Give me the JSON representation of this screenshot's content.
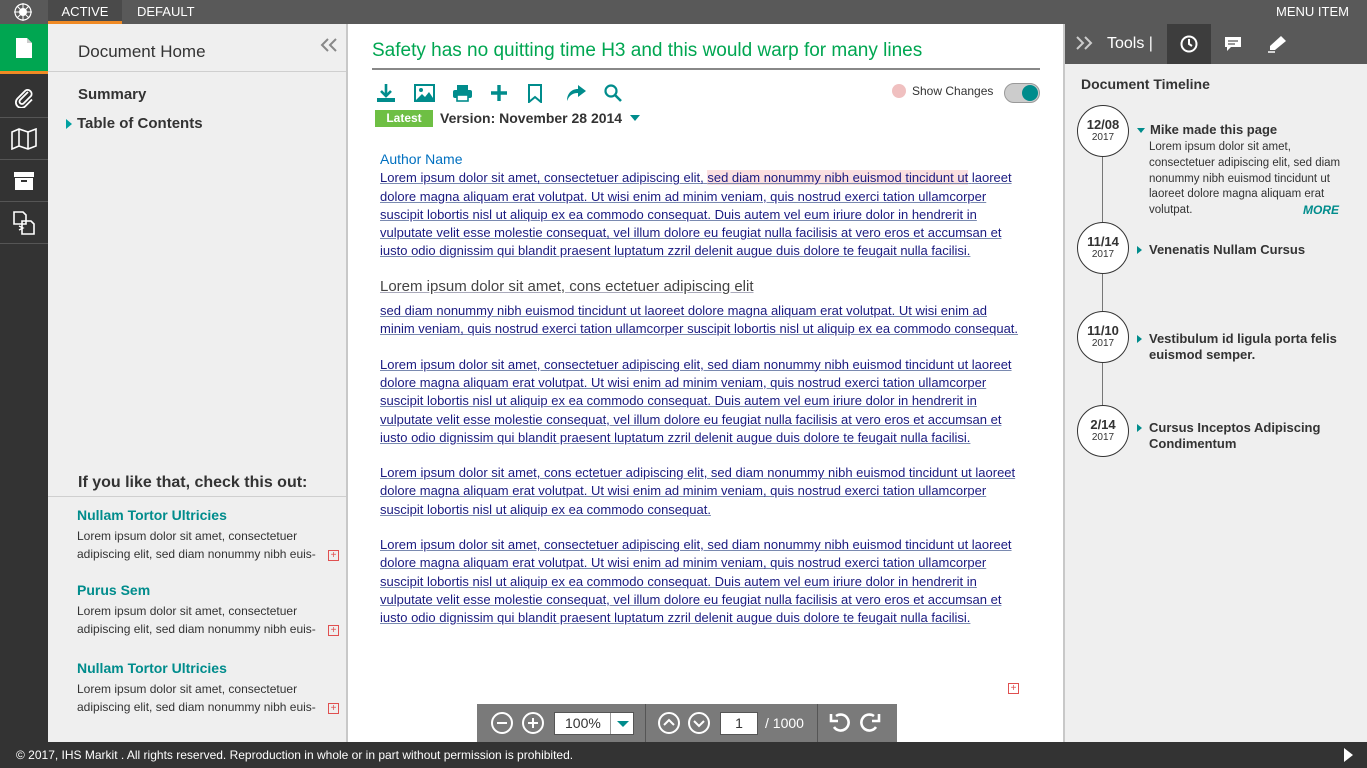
{
  "topbar": {
    "tabs": [
      "ACTIVE",
      "DEFAULT"
    ],
    "menu_item": "MENU ITEM"
  },
  "rail": {
    "icons": [
      "document-icon",
      "paperclip-icon",
      "map-icon",
      "archive-icon",
      "compare-icon"
    ]
  },
  "left_panel": {
    "home_label": "Document Home",
    "summary_label": "Summary",
    "toc_label": "Table of Contents",
    "related_title": "If you like that, check this out:",
    "related": [
      {
        "title": "Nullam Tortor Ultricies",
        "desc": "Lorem ipsum dolor sit amet, consectetuer adipiscing elit, sed diam nonummy nibh euis-"
      },
      {
        "title": "Purus Sem",
        "desc": "Lorem ipsum dolor sit amet, consectetuer adipiscing elit, sed diam nonummy nibh euis-"
      },
      {
        "title": "Nullam Tortor Ultricies",
        "desc": "Lorem ipsum dolor sit amet, consectetuer adipiscing elit, sed diam nonummy nibh euis-"
      }
    ]
  },
  "main": {
    "title": "Safety has no quitting time H3 and this would warp for many lines",
    "show_changes_label": "Show Changes",
    "latest_badge": "Latest",
    "version_label": "Version: November 28 2014",
    "author": "Author Name",
    "p1_a": "Lorem ipsum dolor sit amet, consectetuer adipiscing elit,",
    "p1_hl": "sed diam nonummy nibh euismod tincidunt ut",
    "p1_b": "laoreet dolore magna aliquam erat volutpat. Ut wisi enim ad minim veniam, quis nostrud exerci tation ullamcorper suscipit lobortis nisl ut aliquip ex ea commodo consequat. Duis autem vel eum iriure dolor in hendrerit in vulputate velit esse molestie consequat, vel illum dolore eu feugiat nulla facilisis at vero eros et accumsan et iusto odio dignissim qui blandit praesent luptatum zzril delenit augue duis dolore te feugait nulla facilisi.",
    "subheading": "Lorem ipsum dolor sit amet, cons ectetuer adipiscing elit",
    "p2": "sed diam nonummy nibh euismod tincidunt ut laoreet dolore magna aliquam erat volutpat. Ut wisi enim ad minim veniam, quis nostrud exerci tation ullamcorper suscipit lobortis nisl ut aliquip ex ea commodo consequat.",
    "p3": "Lorem ipsum dolor sit amet, consectetuer adipiscing elit, sed diam nonummy nibh euismod tincidunt ut laoreet dolore magna aliquam erat volutpat. Ut wisi enim ad minim veniam, quis nostrud exerci tation ullamcorper suscipit lobortis nisl ut aliquip ex ea commodo consequat. Duis autem vel eum iriure dolor in hendrerit in vulputate velit esse molestie consequat, vel illum dolore eu feugiat nulla facilisis at vero eros et accumsan et iusto odio dignissim qui blandit praesent luptatum zzril delenit augue duis dolore te feugait nulla facilisi.",
    "p4": "Lorem ipsum dolor sit amet, cons ectetuer adipiscing elit, sed diam nonummy nibh euismod tincidunt ut laoreet dolore magna aliquam erat volutpat. Ut wisi enim ad minim veniam, quis nostrud exerci tation ullamcorper suscipit lobortis nisl ut aliquip ex ea commodo consequat.",
    "p5": "Lorem ipsum dolor sit amet, consectetuer adipiscing elit, sed diam nonummy nibh euismod tincidunt ut laoreet dolore magna aliquam erat volutpat. Ut wisi enim ad minim veniam, quis nostrud exerci tation ullamcorper suscipit lobortis nisl ut aliquip ex ea commodo consequat. Duis autem vel eum iriure dolor in hendrerit in vulputate velit esse molestie consequat, vel illum dolore eu feugiat nulla facilisis at vero eros et accumsan et iusto odio dignissim qui blandit praesent luptatum zzril delenit augue duis dolore te feugait nulla facilisi."
  },
  "pager": {
    "zoom": "100%",
    "page": "1",
    "total": "/ 1000"
  },
  "right_panel": {
    "tools_label": "Tools  |",
    "timeline_title": "Document Timeline",
    "entries": [
      {
        "date": "12/08",
        "year": "2017",
        "title": "Mike made this page",
        "desc": "Lorem ipsum dolor sit amet, consectetuer adipiscing elit, sed diam nonummy nibh euismod tincidunt ut laoreet dolore magna aliquam erat volutpat.",
        "more": "MORE"
      },
      {
        "date": "11/14",
        "year": "2017",
        "title": "Venenatis Nullam Cursus"
      },
      {
        "date": "11/10",
        "year": "2017",
        "title": "Vestibulum id ligula porta felis euismod semper."
      },
      {
        "date": "2/14",
        "year": "2017",
        "title": "Cursus Inceptos Adipiscing Condimentum"
      }
    ]
  },
  "footer": {
    "text": "© 2017, IHS Markit    . All rights reserved. Reproduction in whole or in part without permission is prohibited."
  },
  "colors": {
    "brand_green": "#00a651",
    "teal": "#008c8c",
    "accent_orange": "#f08a24",
    "dark": "#333333"
  }
}
